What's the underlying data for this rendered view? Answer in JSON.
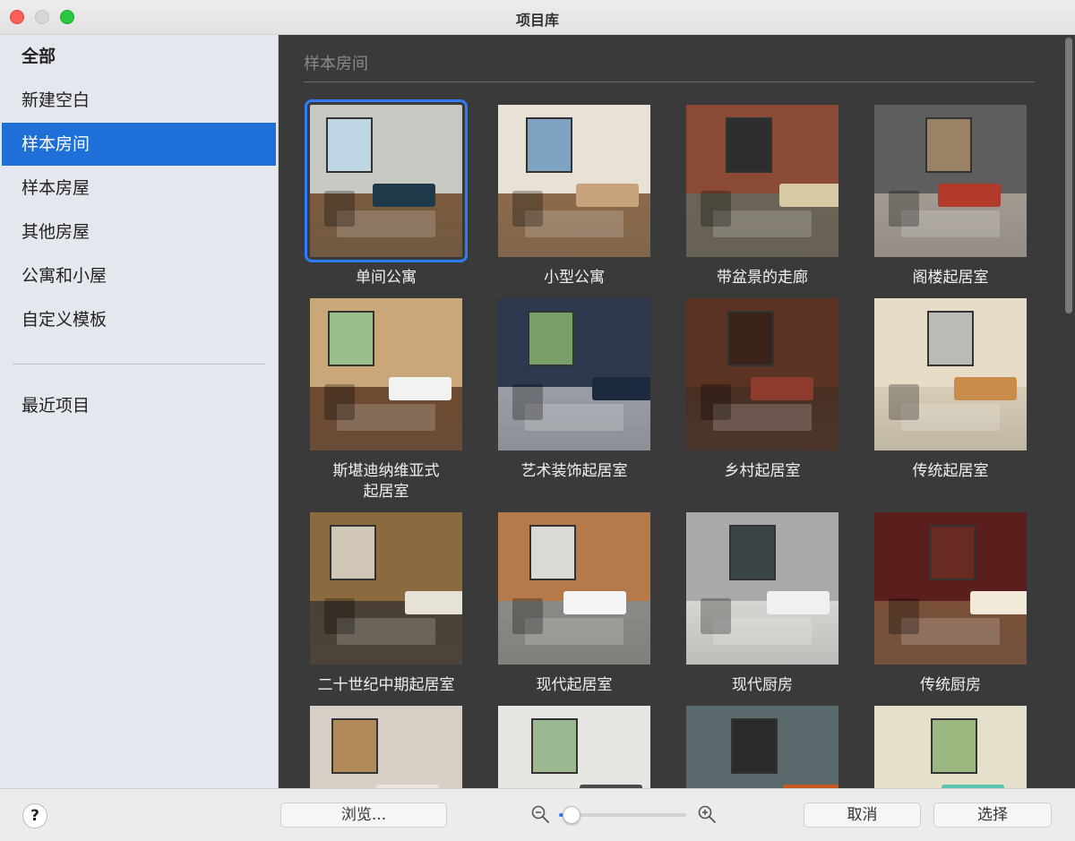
{
  "window": {
    "title": "项目库"
  },
  "sidebar": {
    "items": [
      {
        "label": "全部"
      },
      {
        "label": "新建空白"
      },
      {
        "label": "样本房间"
      },
      {
        "label": "样本房屋"
      },
      {
        "label": "其他房屋"
      },
      {
        "label": "公寓和小屋"
      },
      {
        "label": "自定义模板"
      }
    ],
    "selected_index": 2,
    "recent_label": "最近项目"
  },
  "main": {
    "section_title": "样本房间",
    "selected_tile_index": 0,
    "tiles": [
      {
        "label": "单间公寓",
        "wall": "#c9c9c4",
        "floor": "#7a5a3e",
        "accent": "#1f3a4a",
        "window": "#bfd6e4"
      },
      {
        "label": "小型公寓",
        "wall": "#e8e2d6",
        "floor": "#8b6a4a",
        "accent": "#c7a27a",
        "window": "#7fa3c2"
      },
      {
        "label": "带盆景的走廊",
        "wall": "#8a4a34",
        "floor": "#6b6456",
        "accent": "#d8c9a5",
        "window": "#2d2d2d"
      },
      {
        "label": "阁楼起居室",
        "wall": "#5e5e5e",
        "floor": "#a39b92",
        "accent": "#b23a2a",
        "window": "#9a8266"
      },
      {
        "label": "斯堪迪纳维亚式\n起居室",
        "wall": "#c9a77a",
        "floor": "#6e4a30",
        "accent": "#f2f2f0",
        "window": "#9bbf8c"
      },
      {
        "label": "艺术装饰起居室",
        "wall": "#2d3a4e",
        "floor": "#9a9ea6",
        "accent": "#1c2a40",
        "window": "#7aa06a"
      },
      {
        "label": "乡村起居室",
        "wall": "#5a3322",
        "floor": "#4a2f22",
        "accent": "#8c3b2c",
        "window": "#3a241a"
      },
      {
        "label": "传统起居室",
        "wall": "#e6dcc8",
        "floor": "#d8cdb6",
        "accent": "#c98c4a",
        "window": "#bcbab4"
      },
      {
        "label": "二十世纪中期起居室",
        "wall": "#8a6a3e",
        "floor": "#4a4034",
        "accent": "#e6e2d8",
        "window": "#cfc6b6"
      },
      {
        "label": "现代起居室",
        "wall": "#b67a4a",
        "floor": "#8a8a86",
        "accent": "#f5f5f5",
        "window": "#d9d9d6"
      },
      {
        "label": "现代厨房",
        "wall": "#a9a9a9",
        "floor": "#d8d6d2",
        "accent": "#f0f0f0",
        "window": "#3b4548"
      },
      {
        "label": "传统厨房",
        "wall": "#5a1e1c",
        "floor": "#7a5038",
        "accent": "#f0e8d8",
        "window": "#6a2a24"
      },
      {
        "label": "",
        "wall": "#d8d0c6",
        "floor": "#7a3a2e",
        "accent": "#e8e4e0",
        "window": "#b08a5a"
      },
      {
        "label": "",
        "wall": "#e6e6e2",
        "floor": "#9a9a96",
        "accent": "#4a4a4a",
        "window": "#9cb890"
      },
      {
        "label": "",
        "wall": "#5a6a6c",
        "floor": "#3a3a3a",
        "accent": "#c4581e",
        "window": "#2a2a2a"
      },
      {
        "label": "",
        "wall": "#e4e0cc",
        "floor": "#c4c0b0",
        "accent": "#5ac4b0",
        "window": "#9ab880"
      }
    ]
  },
  "bottom": {
    "help_label": "?",
    "browse_label": "浏览...",
    "zoom": {
      "value": 0.1,
      "zoom_out_icon": "zoom-out-icon",
      "zoom_in_icon": "zoom-in-icon"
    },
    "cancel_label": "取消",
    "select_label": "选择",
    "accent_color": "#2f7cf6"
  }
}
